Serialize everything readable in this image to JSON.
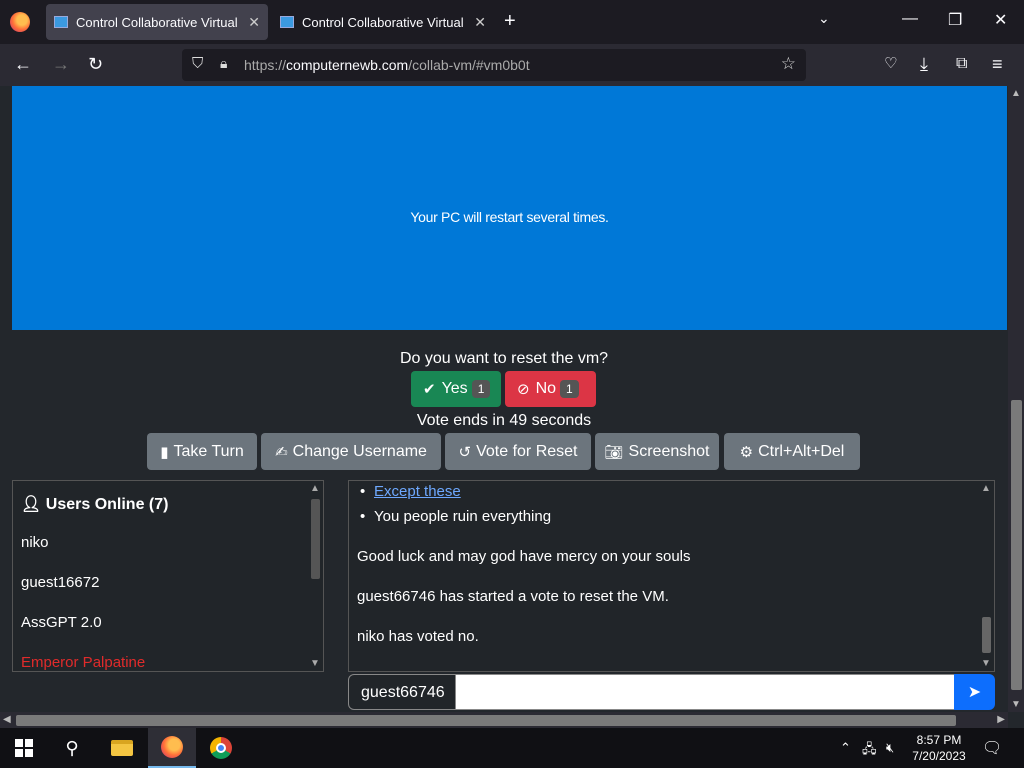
{
  "browser": {
    "tabs": [
      {
        "title": "Control Collaborative Virtual M",
        "active": true
      },
      {
        "title": "Control Collaborative Virtual M",
        "active": false
      }
    ],
    "url_prefix": "https://",
    "url_host": "computernewb.com",
    "url_path": "/collab-vm/#vm0b0t"
  },
  "vm": {
    "screen_text": "Your PC will restart several times.",
    "screen_color": "#0078d7"
  },
  "vote": {
    "question": "Do you want to reset the vm?",
    "yes_label": "Yes",
    "yes_count": "1",
    "no_label": "No",
    "no_count": "1",
    "timer": "Vote ends in 49 seconds"
  },
  "actions": {
    "take_turn": "Take Turn",
    "change_username": "Change Username",
    "vote_reset": "Vote for Reset",
    "screenshot": "Screenshot",
    "ctrl_alt_del": "Ctrl+Alt+Del"
  },
  "users": {
    "heading": "Users Online (7)",
    "list": [
      {
        "name": "niko"
      },
      {
        "name": "guest16672"
      },
      {
        "name": "AssGPT 2.0"
      },
      {
        "name": "Emperor Palpatine"
      }
    ]
  },
  "chat": {
    "bullets": [
      {
        "text": "Except these",
        "link": true
      },
      {
        "text": "You people ruin everything",
        "link": false
      }
    ],
    "messages": [
      "Good luck and may god have mercy on your souls",
      "guest66746 has started a vote to reset the VM.",
      "niko has voted no."
    ],
    "username": "guest66746",
    "input_value": ""
  },
  "taskbar": {
    "time": "8:57 PM",
    "date": "7/20/2023"
  },
  "colors": {
    "yes": "#198754",
    "no": "#dc3545",
    "send": "#0d6efd",
    "admin_user": "#e02b2b"
  }
}
